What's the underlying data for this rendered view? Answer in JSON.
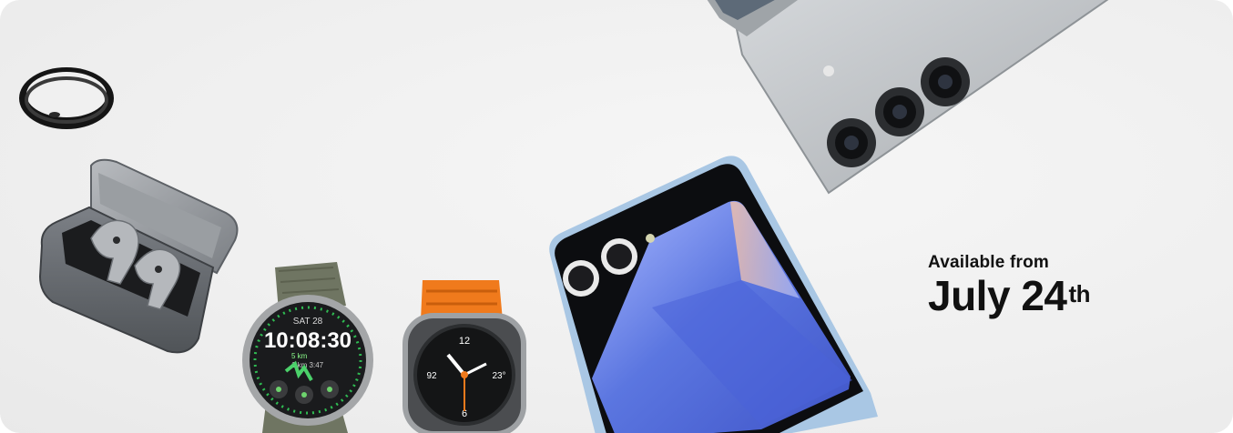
{
  "banner": {
    "availability_label": "Available from",
    "availability_date": "July 24",
    "availability_suffix": "th"
  },
  "watch_green": {
    "date": "SAT 28",
    "time": "10:08:30",
    "small_1": "5 km",
    "small_2": "1 km 3:47"
  },
  "watch_orange": {
    "top_num": "12",
    "left_num": "92",
    "right_num": "23°",
    "bottom_num": "6"
  },
  "products": [
    {
      "name": "galaxy-ring-icon"
    },
    {
      "name": "galaxy-buds-case-icon"
    },
    {
      "name": "galaxy-watch-green-icon"
    },
    {
      "name": "galaxy-watch-ultra-icon"
    },
    {
      "name": "galaxy-z-flip-phone-icon"
    },
    {
      "name": "galaxy-z-fold-phone-icon"
    }
  ],
  "colors": {
    "background": "#efefef",
    "text": "#111111",
    "watch_band_green": "#6f7562",
    "watch_band_orange": "#f07a1c",
    "flip_screen_blue": "#5b76e0",
    "fold_body": "#b9bcbf"
  }
}
